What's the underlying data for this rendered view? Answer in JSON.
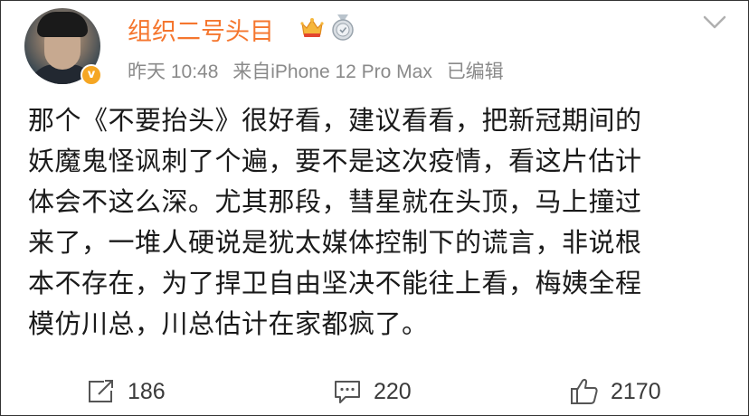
{
  "post": {
    "username": "组织二号头目",
    "verified_mark": "v",
    "time": "昨天 10:48",
    "source": "来自iPhone 12 Pro Max",
    "edited": "已编辑",
    "text": "那个《不要抬头》很好看，建议看看，把新冠期间的\n妖魔鬼怪讽刺了个遍，要不是这次疫情，看这片估计\n体会不这么深。尤其那段，彗星就在头顶，马上撞过\n来了，一堆人硬说是犹太媒体控制下的谎言，非说根\n本不存在，为了捍卫自由坚决不能往上看，梅姨全程\n模仿川总，川总估计在家都疯了。"
  },
  "actions": {
    "repost_count": "186",
    "comment_count": "220",
    "like_count": "2170"
  },
  "icons": {
    "avatar": "profile-photo",
    "verified": "verified-v-icon",
    "crown": "crown-badge-icon",
    "medal": "medal-badge-icon",
    "menu": "chevron-down-icon",
    "repost": "repost-icon",
    "comment": "comment-icon",
    "like": "thumbs-up-icon"
  },
  "colors": {
    "username": "#f5762e",
    "meta": "#8a8a8a",
    "text": "#1a1a1a",
    "verified": "#f5a623"
  }
}
